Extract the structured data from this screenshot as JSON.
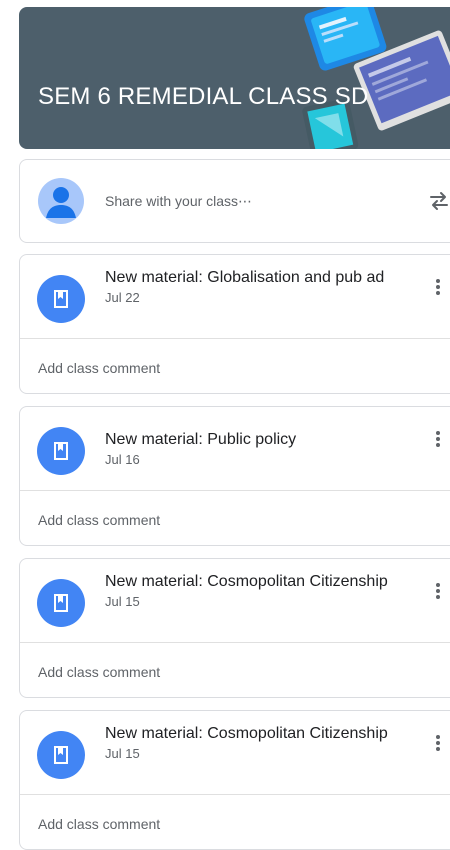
{
  "class": {
    "title": "SEM 6 REMEDIAL CLASS SD"
  },
  "share": {
    "placeholder": "Share with your class⋯",
    "avatar_icon": "avatar-icon",
    "repost_icon": "repost-icon"
  },
  "posts": [
    {
      "title": "New material: Globalisation and pub ad",
      "date": "Jul 22",
      "comment": "Add class comment",
      "icon": "material-icon"
    },
    {
      "title": "New material: Public policy",
      "date": "Jul 16",
      "comment": "Add class comment",
      "icon": "material-icon"
    },
    {
      "title": "New material: Cosmopolitan Citizenship",
      "date": "Jul 15",
      "comment": "Add class comment",
      "icon": "material-icon"
    },
    {
      "title": "New material: Cosmopolitan Citizenship",
      "date": "Jul 15",
      "comment": "Add class comment",
      "icon": "material-icon"
    }
  ],
  "colors": {
    "banner": "#4d5f6b",
    "accent": "#4285f4",
    "text_secondary": "#5f6368"
  }
}
